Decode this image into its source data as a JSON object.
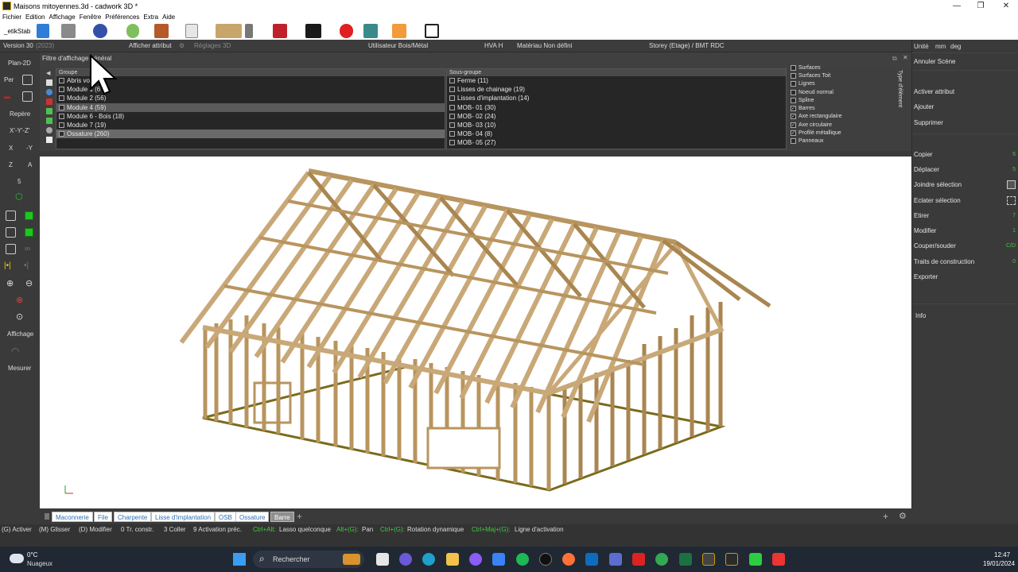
{
  "window": {
    "title": "Maisons mitoyennes.3d - cadwork 3D *",
    "controls": [
      "—",
      "❐",
      "✕"
    ]
  },
  "menu": [
    "Fichier",
    "Edition",
    "Affichage",
    "Fenêtre",
    "Préférences",
    "Extra",
    "Aide"
  ],
  "toolbar": {
    "label": "_etikStab"
  },
  "inforow": {
    "version": "Version 30",
    "year": "(2023)",
    "afficher_attribut": "Afficher attribut",
    "reglages": "Réglages 3D",
    "utilisateur": "Utilisateur Bois/Métal",
    "hva": "HVA H",
    "materiau": "Matériau Non défini",
    "storey": "Storey (Etage) / BMT RDC"
  },
  "left_rail": {
    "plan2d": "Plan-2D",
    "per": "Per",
    "repere": "Repère",
    "xyz": "X'-Y'-Z'",
    "x": "X",
    "neg_y": "-Y",
    "z": "Z",
    "a": "A",
    "five": "5",
    "affichage": "Affichage",
    "mesurer": "Mesurer"
  },
  "filter": {
    "title": "Filtre d'affichage général",
    "group_header": "Groupe",
    "subgroup_header": "Sous-groupe",
    "element_type_label": "Type d'élément",
    "groups": [
      "Abris vo",
      "Module 1 (6",
      "Module 2 (56)",
      "Module 4 (59)",
      "Module 6 - Bois (18)",
      "Module 7 (19)",
      "Ossature (260)"
    ],
    "subgroups": [
      "Ferme (11)",
      "Lisses de chainage (19)",
      "Lisses d'implantation (14)",
      "MOB- 01 (30)",
      "MOB- 02 (24)",
      "MOB- 03 (10)",
      "MOB- 04 (8)",
      "MOB- 05 (27)"
    ],
    "element_types": [
      {
        "label": "Surfaces",
        "checked": false
      },
      {
        "label": "Surfaces Toit",
        "checked": false
      },
      {
        "label": "Lignes",
        "checked": false
      },
      {
        "label": "Noeud normal",
        "checked": false
      },
      {
        "label": "Spline",
        "checked": false
      },
      {
        "label": "Barres",
        "checked": true
      },
      {
        "label": "Axe rectangulaire",
        "checked": true
      },
      {
        "label": "Axe circulaire",
        "checked": true
      },
      {
        "label": "Profilé métallique",
        "checked": true
      },
      {
        "label": "Panneaux",
        "checked": false
      }
    ]
  },
  "right_panel": {
    "units_label": "Unité",
    "unit_len": "mm",
    "unit_ang": "deg",
    "items": [
      {
        "label": "Annuler Scène",
        "key": ""
      },
      {
        "label": "Activer attribut",
        "key": ""
      },
      {
        "label": "Ajouter",
        "key": ""
      },
      {
        "label": "Supprimer",
        "key": ""
      },
      {
        "label": "Copier",
        "key": "6"
      },
      {
        "label": "Déplacer",
        "key": "5"
      },
      {
        "label": "Joindre sélection",
        "key": ""
      },
      {
        "label": "Eclater sélection",
        "key": ""
      },
      {
        "label": "Etirer",
        "key": "7"
      },
      {
        "label": "Modifier",
        "key": "1"
      },
      {
        "label": "Couper/souder",
        "key": "C/D"
      },
      {
        "label": "Traits de construction",
        "key": "0"
      },
      {
        "label": "Exporter",
        "key": ""
      },
      {
        "label": "Info",
        "key": ""
      }
    ]
  },
  "tabs": [
    "Maconnerie",
    "File",
    "Charpente",
    "Lisse d'implantation",
    "OSB",
    "Ossature",
    "Barre"
  ],
  "tab_plus": "+",
  "status": {
    "activer": "(G) Activer",
    "glisser": "(M) Glisser",
    "modifier": "(D) Modifier",
    "tr_constr": "0 Tr. constr.",
    "coller": "3 Coller",
    "activation": "9 Activation préc.",
    "lasso_key": "Ctrl+Alt:",
    "lasso": "Lasso quelconque",
    "pan_key": "Alt+(G):",
    "pan": "Pan",
    "rot_key": "Ctrl+(G):",
    "rot": "Rotation dynamique",
    "ligne_key": "Ctrl+Maj+(G):",
    "ligne": "Ligne d'activation"
  },
  "taskbar": {
    "temp": "0°C",
    "weather": "Nuageux",
    "search": "Rechercher",
    "time": "12:47",
    "date": "19/01/2024"
  },
  "colors": {
    "wood": "#c9a878",
    "wood_dark": "#8f6f45",
    "accent_green": "#3ccf3c",
    "viewport_bg": "#ffffff"
  }
}
